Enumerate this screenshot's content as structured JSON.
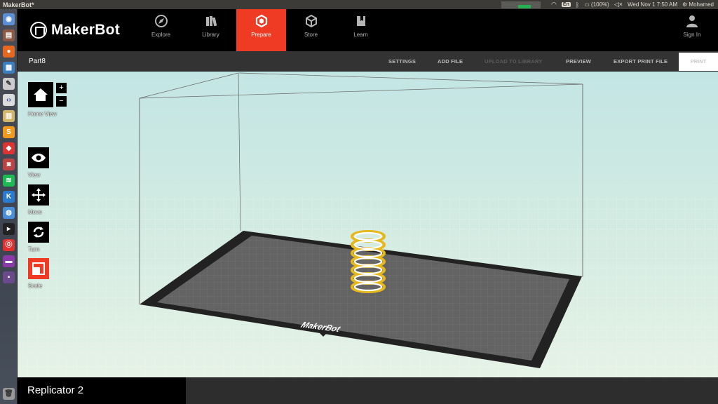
{
  "os": {
    "window_title": "MakerBot*",
    "battery": "(100%)",
    "keyboard": "En",
    "clock": "Wed Nov  1  7:50 AM",
    "user": "Mohamed"
  },
  "app": {
    "logo_text": "MakerBot",
    "nav": [
      {
        "label": "Explore",
        "icon": "compass-icon"
      },
      {
        "label": "Library",
        "icon": "library-icon"
      },
      {
        "label": "Prepare",
        "icon": "prepare-icon",
        "active": true
      },
      {
        "label": "Store",
        "icon": "cube-icon"
      },
      {
        "label": "Learn",
        "icon": "book-icon"
      }
    ],
    "sign_in": "Sign In",
    "accent": "#ef3b24"
  },
  "toolbar": {
    "document": "Part8",
    "settings": "SETTINGS",
    "add_file": "ADD FILE",
    "upload": "UPLOAD TO LIBRARY",
    "preview": "PREVIEW",
    "export": "EXPORT PRINT FILE",
    "print": "PRINT"
  },
  "tools": {
    "home_view": "Home View",
    "zoom_in": "+",
    "zoom_out": "−",
    "view": "View",
    "move": "Move",
    "turn": "Turn",
    "scale": "Scale"
  },
  "build_plate": {
    "brand": "MakerBot"
  },
  "footer": {
    "printer": "Replicator 2"
  }
}
